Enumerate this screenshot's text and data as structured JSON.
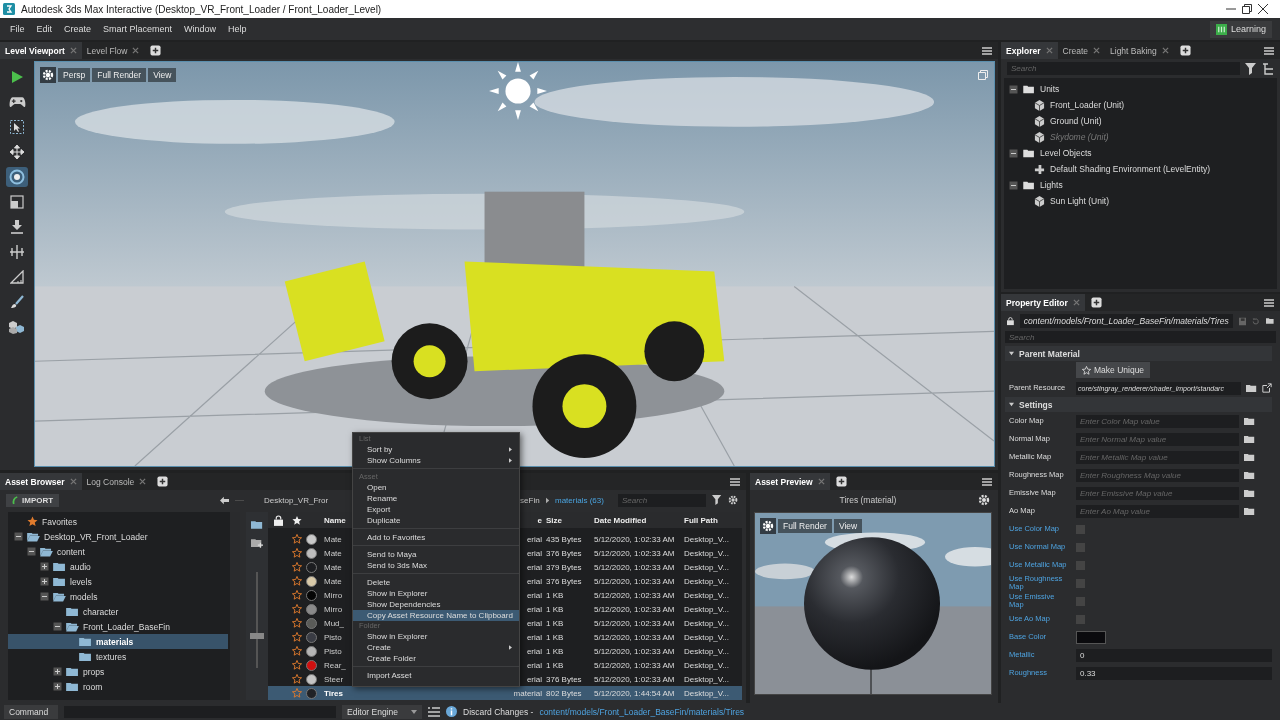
{
  "window": {
    "title": "Autodesk 3ds Max Interactive (Desktop_VR_Front_Loader / Front_Loader_Level)"
  },
  "menu": [
    "File",
    "Edit",
    "Create",
    "Smart Placement",
    "Window",
    "Help"
  ],
  "learning_button": {
    "label": "Learning"
  },
  "viewport_panel": {
    "tabs": [
      {
        "label": "Level Viewport",
        "selected": true
      },
      {
        "label": "Level Flow",
        "selected": false
      }
    ],
    "tools": [
      {
        "kind": "play",
        "selected": false
      },
      {
        "kind": "gamepad",
        "selected": false
      },
      {
        "kind": "select",
        "selected": false
      },
      {
        "kind": "move",
        "selected": false
      },
      {
        "kind": "rotate",
        "selected": true
      },
      {
        "kind": "scale",
        "selected": false
      },
      {
        "kind": "drop",
        "selected": false
      },
      {
        "kind": "snap",
        "selected": false
      },
      {
        "kind": "measure",
        "selected": false
      },
      {
        "kind": "brush",
        "selected": false
      },
      {
        "kind": "cubes",
        "selected": false
      }
    ],
    "view_buttons": [
      "Persp",
      "Full Render",
      "View"
    ]
  },
  "explorer": {
    "tabs": [
      {
        "label": "Explorer",
        "selected": true
      },
      {
        "label": "Create",
        "selected": false
      },
      {
        "label": "Light Baking",
        "selected": false
      }
    ],
    "search": {
      "placeholder": "Search"
    },
    "tree": [
      {
        "label": "Units",
        "kind": "folder",
        "expanded": true,
        "children": [
          {
            "label": "Front_Loader (Unit)",
            "kind": "unit",
            "hidden": false
          },
          {
            "label": "Ground (Unit)",
            "kind": "unit",
            "hidden": false
          },
          {
            "label": "Skydome (Unit)",
            "kind": "unit",
            "hidden": true
          }
        ]
      },
      {
        "label": "Level Objects",
        "kind": "folder",
        "expanded": true,
        "children": [
          {
            "label": "Default Shading Environment (LevelEntity)",
            "kind": "entity",
            "hidden": false
          }
        ]
      },
      {
        "label": "Lights",
        "kind": "folder",
        "expanded": true,
        "children": [
          {
            "label": "Sun Light (Unit)",
            "kind": "unit",
            "hidden": false
          }
        ]
      }
    ]
  },
  "property_editor": {
    "tabs": [
      {
        "label": "Property Editor",
        "selected": true
      }
    ],
    "path": "content/models/Front_Loader_BaseFin/materials/Tires",
    "search": {
      "placeholder": "Search"
    },
    "parent_material": {
      "title": "Parent Material",
      "expanded": true,
      "button": "Make Unique",
      "resource_label": "Parent Resource",
      "resource_value": "core/stingray_renderer/shader_import/standarc"
    },
    "settings": {
      "title": "Settings",
      "expanded": true,
      "properties": [
        {
          "kind": "map",
          "label": "Color Map",
          "placeholder": "Enter Color Map value"
        },
        {
          "kind": "map",
          "label": "Normal Map",
          "placeholder": "Enter Normal Map value"
        },
        {
          "kind": "map",
          "label": "Metallic Map",
          "placeholder": "Enter Metallic Map value"
        },
        {
          "kind": "map",
          "label": "Roughness Map",
          "placeholder": "Enter Roughness Map value"
        },
        {
          "kind": "map",
          "label": "Emissive Map",
          "placeholder": "Enter Emissive Map value"
        },
        {
          "kind": "map",
          "label": "Ao Map",
          "placeholder": "Enter Ao Map value"
        },
        {
          "kind": "check",
          "label": "Use Color Map",
          "checked": false
        },
        {
          "kind": "check",
          "label": "Use Normal Map",
          "checked": false
        },
        {
          "kind": "check",
          "label": "Use Metallic Map",
          "checked": false
        },
        {
          "kind": "check",
          "label": "Use Roughness Map",
          "checked": false
        },
        {
          "kind": "check",
          "label": "Use Emissive Map",
          "checked": false
        },
        {
          "kind": "check",
          "label": "Use Ao Map",
          "checked": false
        },
        {
          "kind": "color",
          "label": "Base Color",
          "color": "#0b0b0e"
        },
        {
          "kind": "number",
          "label": "Metallic",
          "value": "0"
        },
        {
          "kind": "number",
          "label": "Roughness",
          "value": "0.33"
        }
      ]
    }
  },
  "asset_browser": {
    "tabs": [
      {
        "label": "Asset Browser",
        "selected": true
      },
      {
        "label": "Log Console",
        "selected": false
      }
    ],
    "import_button": "IMPORT",
    "breadcrumb": [
      {
        "label": "Desktop_VR_Fror",
        "current": false
      },
      {
        "label": "seFin",
        "current": false
      },
      {
        "label": "materials (63)",
        "current": true
      }
    ],
    "search": {
      "placeholder": "Search"
    },
    "tree": [
      {
        "label": "Favorites",
        "kind": "favorites",
        "selected": false
      },
      {
        "label": "Desktop_VR_Front_Loader",
        "kind": "folder",
        "expanded": true,
        "selected": false,
        "children": [
          {
            "label": "content",
            "kind": "folder",
            "expanded": true,
            "selected": false,
            "children": [
              {
                "label": "audio",
                "kind": "folder",
                "expanded": false,
                "selected": false
              },
              {
                "label": "levels",
                "kind": "folder",
                "expanded": false,
                "selected": false
              },
              {
                "label": "models",
                "kind": "folder",
                "expanded": true,
                "selected": false,
                "children": [
                  {
                    "label": "character",
                    "kind": "folder",
                    "selected": false
                  },
                  {
                    "label": "Front_Loader_BaseFin",
                    "kind": "folder",
                    "expanded": true,
                    "selected": false,
                    "children": [
                      {
                        "label": "materials",
                        "kind": "folder",
                        "selected": true
                      },
                      {
                        "label": "textures",
                        "kind": "folder",
                        "selected": false
                      }
                    ]
                  },
                  {
                    "label": "props",
                    "kind": "folder",
                    "expanded": false,
                    "selected": false
                  },
                  {
                    "label": "room",
                    "kind": "folder",
                    "expanded": false,
                    "selected": false
                  }
                ]
              }
            ]
          }
        ]
      }
    ],
    "thumbnail_size": {
      "level": 0.3
    },
    "columns": [
      "Name",
      "e",
      "Size",
      "Date Modified",
      "Full Path"
    ],
    "rows": [
      {
        "name": "Mate",
        "type": "erial",
        "size": "435 Bytes",
        "date": "5/12/2020, 1:02:33 AM",
        "path": "Desktop_V...",
        "color": "#c9c9c9",
        "selected": false
      },
      {
        "name": "Mate",
        "type": "erial",
        "size": "376 Bytes",
        "date": "5/12/2020, 1:02:33 AM",
        "path": "Desktop_V...",
        "color": "#bdbdbd",
        "selected": false
      },
      {
        "name": "Mate",
        "type": "erial",
        "size": "379 Bytes",
        "date": "5/12/2020, 1:02:33 AM",
        "path": "Desktop_V...",
        "color": "#1c1d20",
        "selected": false
      },
      {
        "name": "Mate",
        "type": "erial",
        "size": "376 Bytes",
        "date": "5/12/2020, 1:02:33 AM",
        "path": "Desktop_V...",
        "color": "#d8c9a8",
        "selected": false
      },
      {
        "name": "Mirro",
        "type": "erial",
        "size": "1 KB",
        "date": "5/12/2020, 1:02:33 AM",
        "path": "Desktop_V...",
        "color": "#050505",
        "selected": false
      },
      {
        "name": "Mirro",
        "type": "erial",
        "size": "1 KB",
        "date": "5/12/2020, 1:02:33 AM",
        "path": "Desktop_V...",
        "color": "#8a8a8a",
        "selected": false
      },
      {
        "name": "Mud_",
        "type": "erial",
        "size": "1 KB",
        "date": "5/12/2020, 1:02:33 AM",
        "path": "Desktop_V...",
        "color": "#5a5b58",
        "selected": false
      },
      {
        "name": "Pisto",
        "type": "erial",
        "size": "1 KB",
        "date": "5/12/2020, 1:02:33 AM",
        "path": "Desktop_V...",
        "color": "#3a3c44",
        "selected": false
      },
      {
        "name": "Pisto",
        "type": "erial",
        "size": "1 KB",
        "date": "5/12/2020, 1:02:33 AM",
        "path": "Desktop_V...",
        "color": "#b5b5b5",
        "selected": false
      },
      {
        "name": "Rear_",
        "type": "erial",
        "size": "1 KB",
        "date": "5/12/2020, 1:02:33 AM",
        "path": "Desktop_V...",
        "color": "#d01010",
        "selected": false
      },
      {
        "name": "Steer",
        "type": "erial",
        "size": "376 Bytes",
        "date": "5/12/2020, 1:02:33 AM",
        "path": "Desktop_V...",
        "color": "#c4c4c4",
        "selected": false
      },
      {
        "name": "Tires",
        "type": "material",
        "size": "802 Bytes",
        "date": "5/12/2020, 1:44:54 AM",
        "path": "Desktop_V...",
        "color": "#202226",
        "selected": true
      }
    ]
  },
  "context_menu": [
    {
      "kind": "header",
      "label": "List"
    },
    {
      "kind": "item",
      "label": "Sort by",
      "submenu": true,
      "selected": false
    },
    {
      "kind": "item",
      "label": "Show Columns",
      "submenu": true,
      "selected": false
    },
    {
      "kind": "separator"
    },
    {
      "kind": "header",
      "label": "Asset"
    },
    {
      "kind": "item",
      "label": "Open",
      "submenu": false,
      "selected": false
    },
    {
      "kind": "item",
      "label": "Rename",
      "submenu": false,
      "selected": false
    },
    {
      "kind": "item",
      "label": "Export",
      "submenu": false,
      "selected": false
    },
    {
      "kind": "item",
      "label": "Duplicate",
      "submenu": false,
      "selected": false
    },
    {
      "kind": "separator"
    },
    {
      "kind": "item",
      "label": "Add to Favorites",
      "submenu": false,
      "selected": false
    },
    {
      "kind": "separator"
    },
    {
      "kind": "item",
      "label": "Send to Maya",
      "submenu": false,
      "selected": false
    },
    {
      "kind": "item",
      "label": "Send to 3ds Max",
      "submenu": false,
      "selected": false
    },
    {
      "kind": "separator"
    },
    {
      "kind": "item",
      "label": "Delete",
      "submenu": false,
      "selected": false
    },
    {
      "kind": "item",
      "label": "Show in Explorer",
      "submenu": false,
      "selected": false
    },
    {
      "kind": "item",
      "label": "Show Dependencies",
      "submenu": false,
      "selected": false
    },
    {
      "kind": "item",
      "label": "Copy Asset Resource Name to Clipboard",
      "submenu": false,
      "selected": true
    },
    {
      "kind": "header",
      "label": "Folder"
    },
    {
      "kind": "item",
      "label": "Show in Explorer",
      "submenu": false,
      "selected": false
    },
    {
      "kind": "item",
      "label": "Create",
      "submenu": true,
      "selected": false
    },
    {
      "kind": "item",
      "label": "Create Folder",
      "submenu": false,
      "selected": false
    },
    {
      "kind": "separator"
    },
    {
      "kind": "item",
      "label": "Import Asset",
      "submenu": false,
      "selected": false
    }
  ],
  "asset_preview": {
    "tabs": [
      {
        "label": "Asset Preview",
        "selected": true
      }
    ],
    "title": "Tires (material)",
    "view_buttons": [
      "Full Render",
      "View"
    ]
  },
  "status_bar": {
    "command": "Command",
    "engine": "Editor Engine",
    "message": "Discard Changes -",
    "link": "content/models/Front_Loader_BaseFin/materials/Tires"
  }
}
